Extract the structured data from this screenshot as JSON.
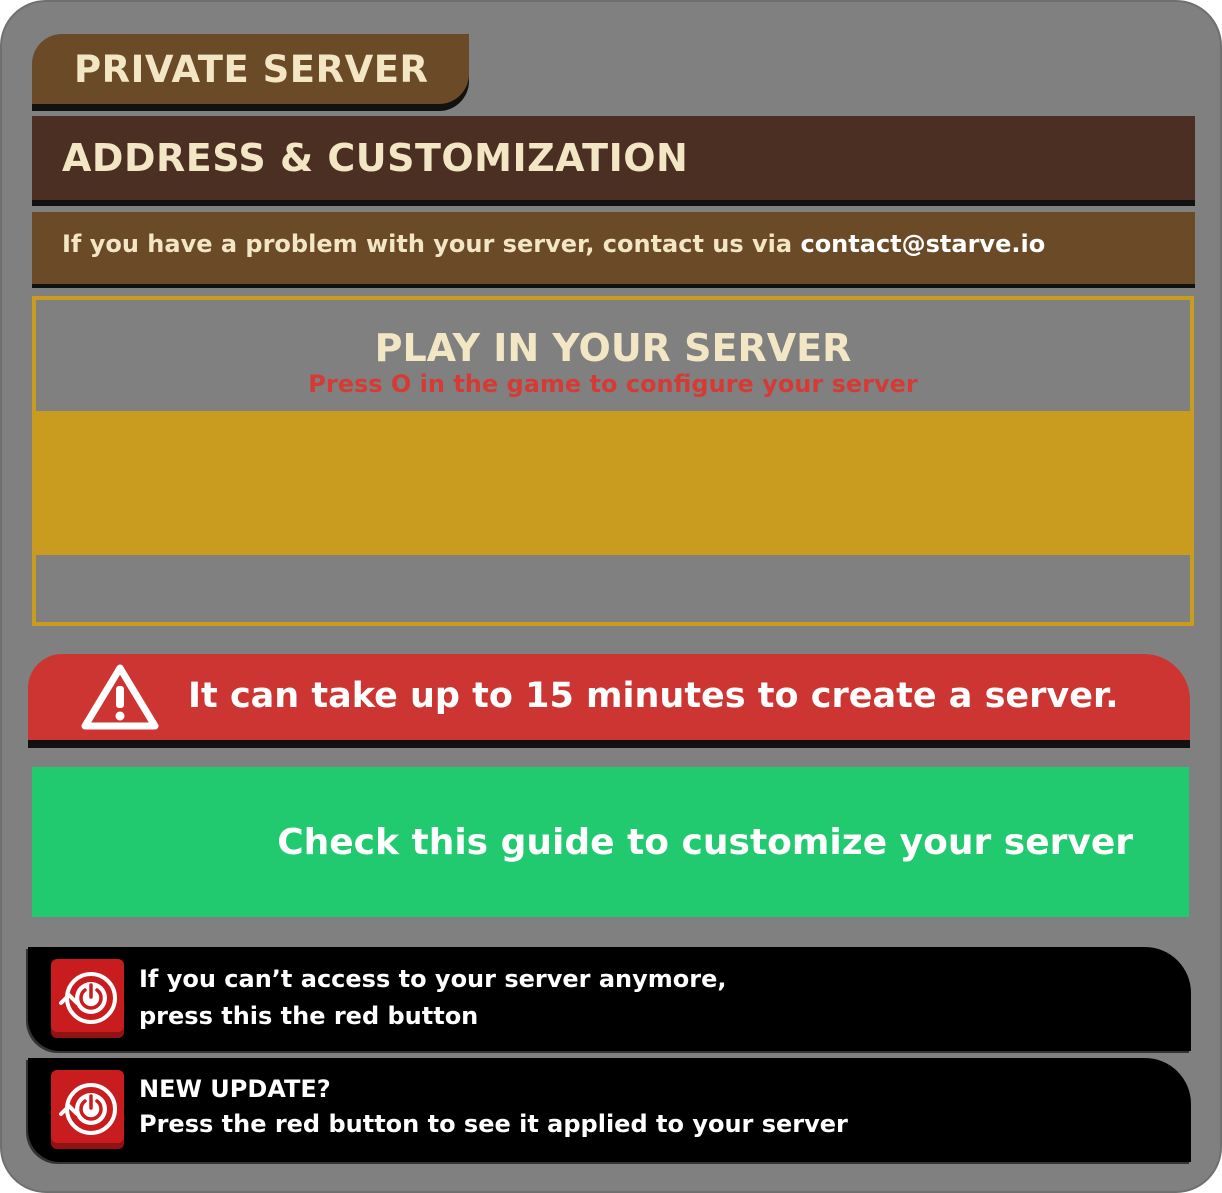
{
  "tab": {
    "title": "PRIVATE SERVER"
  },
  "address": {
    "title": "ADDRESS & CUSTOMIZATION"
  },
  "contact": {
    "text": "If you have a problem with your server, contact us via ",
    "email": "contact@starve.io"
  },
  "play": {
    "title": "PLAY IN YOUR SERVER",
    "subtitle": "Press O in the game to configure your server"
  },
  "warning": {
    "text": "It can take up to 15 minutes to create a server."
  },
  "guide": {
    "label": "Check this guide to customize your server"
  },
  "reset_rows": [
    {
      "line1": "If you can’t access to your server anymore,",
      "line2": "press this the red button"
    },
    {
      "line1": "NEW UPDATE?",
      "line2": "Press the red button to see it applied to your server"
    }
  ],
  "colors": {
    "panel": "#808080",
    "tab": "#6b4b27",
    "address_bar": "#4a2f22",
    "gold": "#c99b1e",
    "warning_red": "#cd3532",
    "guide_green": "#21c96f",
    "button_red": "#c81c1e",
    "cream_text": "#f3e6c4"
  },
  "icons": {
    "warning": "warning-triangle-icon",
    "reset": "power-restart-icon"
  }
}
